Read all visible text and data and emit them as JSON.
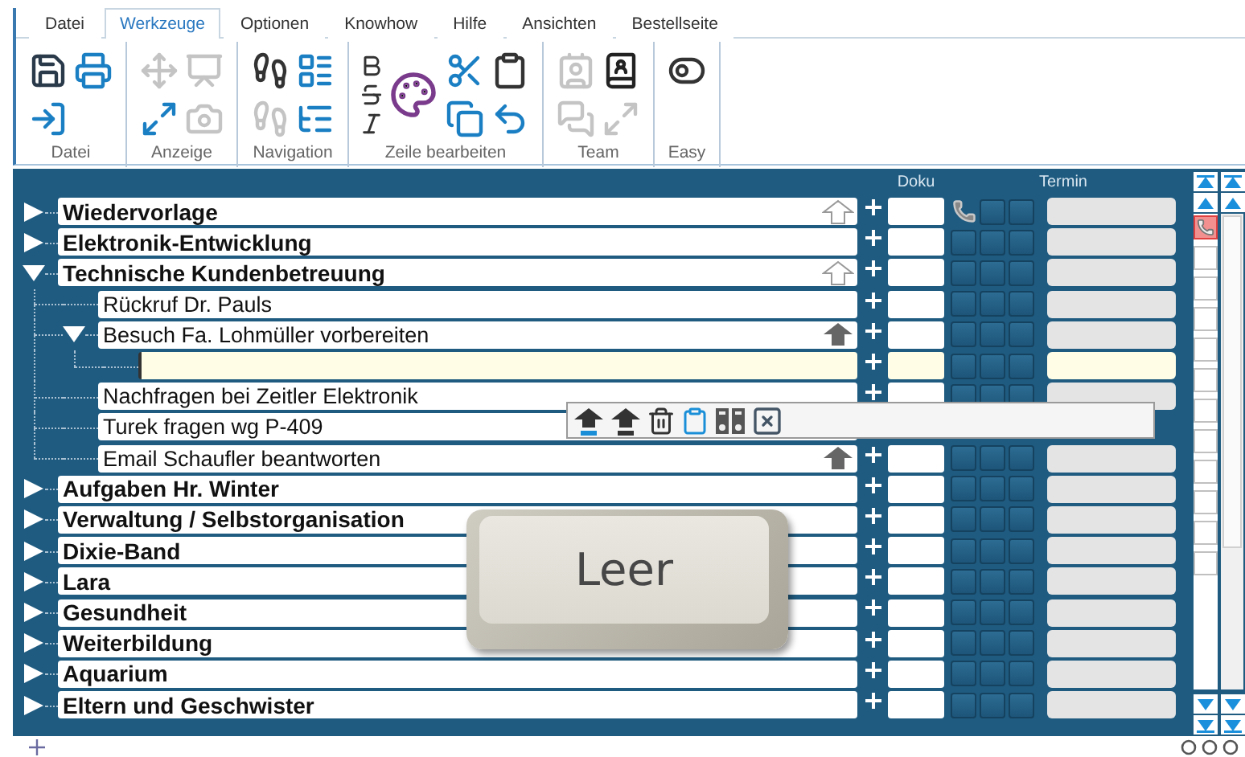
{
  "tabs": [
    {
      "label": "Datei",
      "selected": false
    },
    {
      "label": "Werkzeuge",
      "selected": true
    },
    {
      "label": "Optionen",
      "selected": false
    },
    {
      "label": "Knowhow",
      "selected": false
    },
    {
      "label": "Hilfe",
      "selected": false
    },
    {
      "label": "Ansichten",
      "selected": false
    },
    {
      "label": "Bestellseite",
      "selected": false
    }
  ],
  "ribbon_groups": [
    {
      "label": "Datei",
      "tools": [
        {
          "disabled": false
        },
        {
          "disabled": false
        },
        {
          "disabled": false
        }
      ]
    },
    {
      "label": "Anzeige",
      "tools": [
        {
          "disabled": true
        },
        {
          "disabled": false
        },
        {
          "disabled": true
        },
        {
          "disabled": true
        }
      ]
    },
    {
      "label": "Navigation",
      "tools": [
        {
          "disabled": false
        },
        {
          "disabled": true
        },
        {
          "disabled": false
        },
        {
          "disabled": false
        }
      ]
    },
    {
      "label": "Zeile bearbeiten",
      "tools": [
        {
          "disabled": false
        },
        {
          "disabled": false
        },
        {
          "disabled": false
        },
        {
          "disabled": false
        },
        {
          "disabled": false
        },
        {
          "disabled": false
        },
        {
          "disabled": false
        },
        {
          "disabled": false
        }
      ]
    },
    {
      "label": "Team",
      "tools": [
        {
          "disabled": true
        },
        {
          "disabled": true
        },
        {
          "disabled": false
        },
        {
          "disabled": true
        }
      ]
    },
    {
      "label": "Easy",
      "tools": [
        {
          "disabled": false
        }
      ]
    }
  ],
  "columns": {
    "doku": "Doku",
    "termin": "Termin"
  },
  "tree": [
    {
      "label": "Wiedervorlage",
      "expanded": false,
      "pinned": true,
      "promoted": false,
      "phone": true
    },
    {
      "label": "Elektronik-Entwicklung",
      "expanded": false,
      "pinned": false,
      "promoted": false,
      "phone": false
    },
    {
      "label": "Technische Kundenbetreuung",
      "expanded": true,
      "pinned": true,
      "promoted": false,
      "phone": false,
      "children": [
        {
          "label": "Rückruf Dr. Pauls",
          "pinned": false,
          "promoted": false,
          "phone": false
        },
        {
          "label": "Besuch Fa. Lohmüller vorbereiten",
          "expanded": true,
          "pinned": false,
          "promoted": true,
          "phone": false,
          "children": [
            {
              "editing": true,
              "pinned": false,
              "promoted": false,
              "phone": false
            }
          ]
        },
        {
          "label": "Nachfragen bei Zeitler Elektronik",
          "pinned": false,
          "promoted": false,
          "phone": false
        },
        {
          "label": "Turek fragen wg P-409",
          "pinned": false,
          "promoted": false,
          "menu_open": true
        },
        {
          "label": "Email Schaufler beantworten",
          "pinned": false,
          "promoted": true,
          "phone": false
        }
      ]
    },
    {
      "label": "Aufgaben Hr. Winter",
      "expanded": false,
      "pinned": false,
      "promoted": false,
      "phone": false
    },
    {
      "label": "Verwaltung / Selbstorganisation",
      "expanded": false,
      "pinned": false,
      "promoted": false,
      "phone": false
    },
    {
      "label": "Dixie-Band",
      "expanded": false,
      "pinned": false,
      "promoted": false,
      "phone": false
    },
    {
      "label": "Lara",
      "expanded": false,
      "pinned": false,
      "promoted": false,
      "phone": false
    },
    {
      "label": "Gesundheit",
      "expanded": false,
      "pinned": false,
      "promoted": false,
      "phone": false
    },
    {
      "label": "Weiterbildung",
      "expanded": false,
      "pinned": false,
      "promoted": false,
      "phone": false
    },
    {
      "label": "Aquarium",
      "expanded": false,
      "pinned": false,
      "promoted": false,
      "phone": false
    },
    {
      "label": "Eltern und Geschwister",
      "expanded": false,
      "pinned": false,
      "promoted": false,
      "phone": false
    }
  ],
  "side_flags": [
    {
      "alert": true
    },
    {
      "alert": false
    },
    {
      "alert": false
    },
    {
      "alert": false
    },
    {
      "alert": false
    },
    {
      "alert": false
    },
    {
      "alert": false
    },
    {
      "alert": false
    },
    {
      "alert": false
    },
    {
      "alert": false
    },
    {
      "alert": false
    },
    {
      "alert": false
    }
  ],
  "key_overlay": {
    "label": "Leer"
  }
}
